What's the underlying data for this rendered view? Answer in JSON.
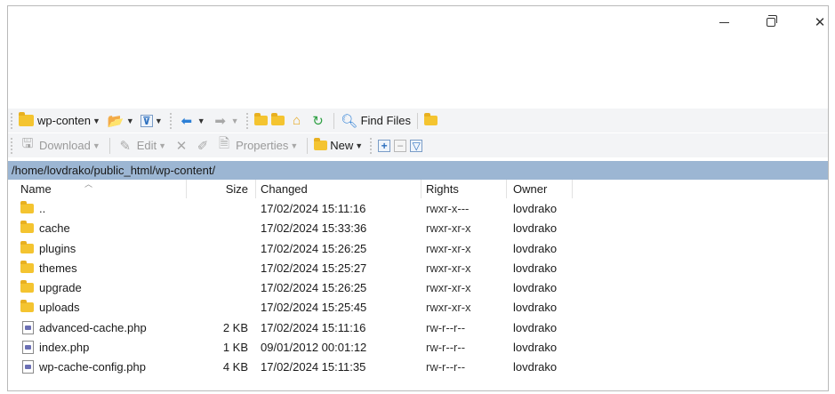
{
  "window": {
    "minimize_label": "minimize",
    "maximize_label": "maximize",
    "close_label": "close"
  },
  "toolbar1": {
    "location_combo": "wp-conten",
    "find_files_label": "Find Files"
  },
  "toolbar2": {
    "download_label": "Download",
    "edit_label": "Edit",
    "properties_label": "Properties",
    "new_label": "New"
  },
  "path": "/home/lovdrako/public_html/wp-content/",
  "columns": {
    "name": "Name",
    "size": "Size",
    "changed": "Changed",
    "rights": "Rights",
    "owner": "Owner"
  },
  "files": [
    {
      "name": "..",
      "type": "parent",
      "size": "",
      "changed": "17/02/2024 15:11:16",
      "rights": "rwxr-x---",
      "owner": "lovdrako"
    },
    {
      "name": "cache",
      "type": "folder",
      "size": "",
      "changed": "17/02/2024 15:33:36",
      "rights": "rwxr-xr-x",
      "owner": "lovdrako"
    },
    {
      "name": "plugins",
      "type": "folder",
      "size": "",
      "changed": "17/02/2024 15:26:25",
      "rights": "rwxr-xr-x",
      "owner": "lovdrako"
    },
    {
      "name": "themes",
      "type": "folder",
      "size": "",
      "changed": "17/02/2024 15:25:27",
      "rights": "rwxr-xr-x",
      "owner": "lovdrako"
    },
    {
      "name": "upgrade",
      "type": "folder",
      "size": "",
      "changed": "17/02/2024 15:26:25",
      "rights": "rwxr-xr-x",
      "owner": "lovdrako"
    },
    {
      "name": "uploads",
      "type": "folder",
      "size": "",
      "changed": "17/02/2024 15:25:45",
      "rights": "rwxr-xr-x",
      "owner": "lovdrako"
    },
    {
      "name": "advanced-cache.php",
      "type": "php",
      "size": "2 KB",
      "changed": "17/02/2024 15:11:16",
      "rights": "rw-r--r--",
      "owner": "lovdrako"
    },
    {
      "name": "index.php",
      "type": "php",
      "size": "1 KB",
      "changed": "09/01/2012 00:01:12",
      "rights": "rw-r--r--",
      "owner": "lovdrako"
    },
    {
      "name": "wp-cache-config.php",
      "type": "php",
      "size": "4 KB",
      "changed": "17/02/2024 15:11:35",
      "rights": "rw-r--r--",
      "owner": "lovdrako"
    }
  ]
}
